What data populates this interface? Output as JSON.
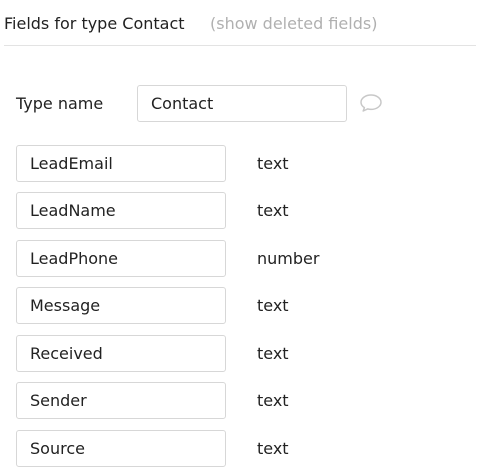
{
  "header": {
    "title": "Fields for type Contact",
    "show_deleted_link": "(show deleted fields)"
  },
  "type_name": {
    "label": "Type name",
    "value": "Contact",
    "comment_icon": "speech-bubble-icon"
  },
  "fields": [
    {
      "name": "LeadEmail",
      "type": "text"
    },
    {
      "name": "LeadName",
      "type": "text"
    },
    {
      "name": "LeadPhone",
      "type": "number"
    },
    {
      "name": "Message",
      "type": "text"
    },
    {
      "name": "Received",
      "type": "text"
    },
    {
      "name": "Sender",
      "type": "text"
    },
    {
      "name": "Source",
      "type": "text"
    }
  ],
  "colors": {
    "text": "#222222",
    "muted_link": "#b0b0b0",
    "border": "#d7d7d7",
    "icon": "#c8c8c8"
  }
}
